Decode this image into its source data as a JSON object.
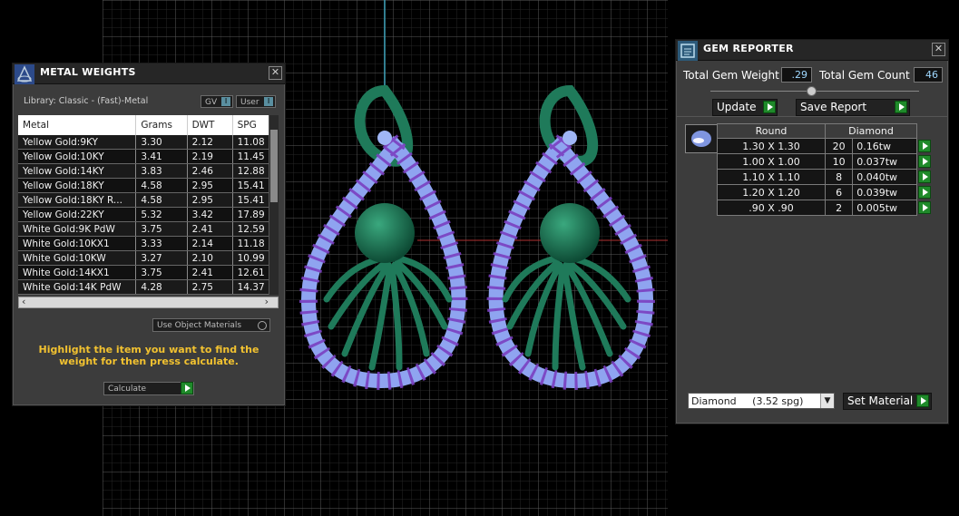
{
  "metal_weights": {
    "title": "METAL WEIGHTS",
    "library": "Library: Classic - (Fast)-Metal",
    "gv_label": "GV",
    "user_label": "User",
    "toggle_glyph": "I",
    "columns": [
      "Metal",
      "Grams",
      "DWT",
      "SPG"
    ],
    "rows": [
      [
        "Yellow Gold:9KY",
        "3.30",
        "2.12",
        "11.08"
      ],
      [
        "Yellow Gold:10KY",
        "3.41",
        "2.19",
        "11.45"
      ],
      [
        "Yellow Gold:14KY",
        "3.83",
        "2.46",
        "12.88"
      ],
      [
        "Yellow Gold:18KY",
        "4.58",
        "2.95",
        "15.41"
      ],
      [
        "Yellow Gold:18KY R...",
        "4.58",
        "2.95",
        "15.41"
      ],
      [
        "Yellow Gold:22KY",
        "5.32",
        "3.42",
        "17.89"
      ],
      [
        "White Gold:9K PdW",
        "3.75",
        "2.41",
        "12.59"
      ],
      [
        "White Gold:10KX1",
        "3.33",
        "2.14",
        "11.18"
      ],
      [
        "White Gold:10KW",
        "3.27",
        "2.10",
        "10.99"
      ],
      [
        "White Gold:14KX1",
        "3.75",
        "2.41",
        "12.61"
      ],
      [
        "White Gold:14K PdW",
        "4.28",
        "2.75",
        "14.37"
      ]
    ],
    "use_object_materials": "Use Object Materials",
    "hint": "Highlight the item you want to find the weight for then press calculate.",
    "calculate": "Calculate"
  },
  "gem_reporter": {
    "title": "GEM REPORTER",
    "total_weight_label": "Total Gem Weight",
    "total_weight_value": ".29",
    "total_count_label": "Total Gem Count",
    "total_count_value": "46",
    "update": "Update",
    "save_report": "Save Report",
    "table_headers": [
      "Round",
      "Diamond"
    ],
    "rows": [
      [
        "1.30 X 1.30",
        "20",
        "0.16tw"
      ],
      [
        "1.00 X 1.00",
        "10",
        "0.037tw"
      ],
      [
        "1.10 X 1.10",
        "8",
        "0.040tw"
      ],
      [
        "1.20 X 1.20",
        "6",
        "0.039tw"
      ],
      [
        ".90 X .90",
        "2",
        "0.005tw"
      ]
    ],
    "material_select": "Diamond     (3.52 spg)",
    "set_material": "Set Material"
  },
  "colors": {
    "background": "#000000",
    "grid": "#3a3a3a",
    "metal": "#1f7a5a",
    "gem": "#8fa4f0",
    "prong": "#7a3fc0",
    "accent_yellow": "#f2c230",
    "button_green": "#1f8a2a"
  },
  "icons": [
    "metal-weights-app-icon",
    "gem-reporter-app-icon",
    "close-icon",
    "play-icon",
    "dropdown-icon",
    "gem-thumbnail-icon"
  ]
}
